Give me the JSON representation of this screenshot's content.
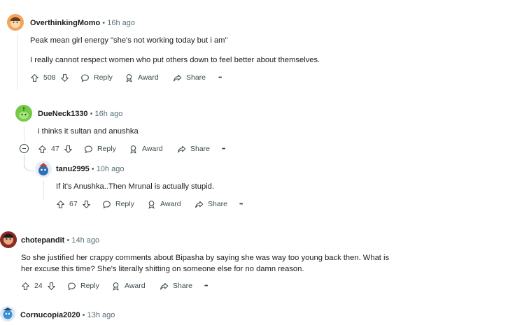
{
  "comments": [
    {
      "username": "OverthinkingMomo",
      "time": "16h ago",
      "lines": [
        "Peak mean girl energy \"she's not working today but i am\"",
        "I really cannot respect women who put others down to feel better about themselves."
      ],
      "votes": "508",
      "reply": "Reply",
      "award": "Award",
      "share": "Share",
      "more": "•••"
    },
    {
      "username": "DueNeck1330",
      "time": "16h ago",
      "lines": [
        "i thinks it sultan and anushka"
      ],
      "votes": "47",
      "reply": "Reply",
      "award": "Award",
      "share": "Share",
      "more": "•••"
    },
    {
      "username": "tanu2995",
      "time": "10h ago",
      "lines": [
        "If it's Anushka..Then Mrunal is actually stupid."
      ],
      "votes": "67",
      "reply": "Reply",
      "award": "Award",
      "share": "Share",
      "more": "•••"
    },
    {
      "username": "chotepandit",
      "time": "14h ago",
      "lines": [
        "So she justified her crappy comments about Bipasha by saying she was way too young back then. What is",
        "her excuse this time? She's literally shitting on someone else for no damn reason."
      ],
      "votes": "24",
      "reply": "Reply",
      "award": "Award",
      "share": "Share",
      "more": "•••"
    },
    {
      "username": "Cornucopia2020",
      "time": "13h ago"
    }
  ],
  "separator": "•",
  "colors": {
    "avatar1": "#f3a55c",
    "avatar2": "#74c947",
    "avatar3": "#2f6fb6",
    "avatar4": "#8a2c22",
    "avatar5": "#3d8fd0"
  }
}
